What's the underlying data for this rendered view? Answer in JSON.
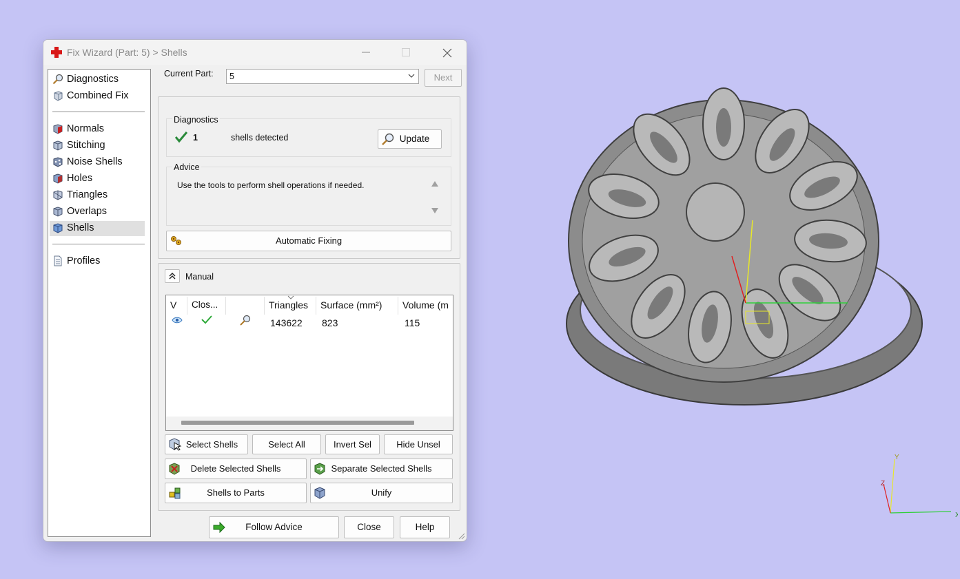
{
  "dialog": {
    "title": "Fix Wizard (Part: 5) > Shells",
    "nav": {
      "items": [
        {
          "label": "Diagnostics",
          "icon": "magnifier-icon"
        },
        {
          "label": "Combined Fix",
          "icon": "cube-fix-icon"
        },
        {
          "label": "Normals",
          "icon": "normals-cube-icon"
        },
        {
          "label": "Stitching",
          "icon": "stitching-cube-icon"
        },
        {
          "label": "Noise Shells",
          "icon": "noise-shells-icon"
        },
        {
          "label": "Holes",
          "icon": "holes-cube-icon"
        },
        {
          "label": "Triangles",
          "icon": "triangles-cube-icon"
        },
        {
          "label": "Overlaps",
          "icon": "overlaps-cube-icon"
        },
        {
          "label": "Shells",
          "icon": "shells-cube-icon",
          "selected": true
        },
        {
          "label": "Profiles",
          "icon": "document-icon"
        }
      ]
    },
    "current_part": {
      "label": "Current Part:",
      "value": "5",
      "next_label": "Next"
    },
    "diagnostics": {
      "label": "Diagnostics",
      "count": "1",
      "text": "shells detected",
      "update_label": "Update"
    },
    "advice": {
      "label": "Advice",
      "text": "Use the tools to perform shell operations if needed."
    },
    "automatic_fixing_label": "Automatic Fixing",
    "manual": {
      "label": "Manual",
      "table": {
        "columns": [
          "V",
          "Clos...",
          "",
          "Triangles",
          "Surface (mm²)",
          "Volume (m"
        ],
        "rows": [
          {
            "triangles": "143622",
            "surface": "823",
            "volume": "115"
          }
        ]
      },
      "buttons": {
        "select_shells": "Select Shells",
        "select_all": "Select All",
        "invert_sel": "Invert Sel",
        "hide_unsel": "Hide Unsel",
        "delete_selected": "Delete Selected Shells",
        "separate_selected": "Separate Selected Shells",
        "shells_to_parts": "Shells to Parts",
        "unify": "Unify"
      }
    },
    "footer": {
      "follow_advice": "Follow Advice",
      "close": "Close",
      "help": "Help"
    }
  },
  "viewport": {
    "background": "#c5c4f5",
    "model": "filigree flower ring",
    "axis_labels": {
      "x": "X",
      "y": "Y",
      "z": "Z"
    }
  }
}
